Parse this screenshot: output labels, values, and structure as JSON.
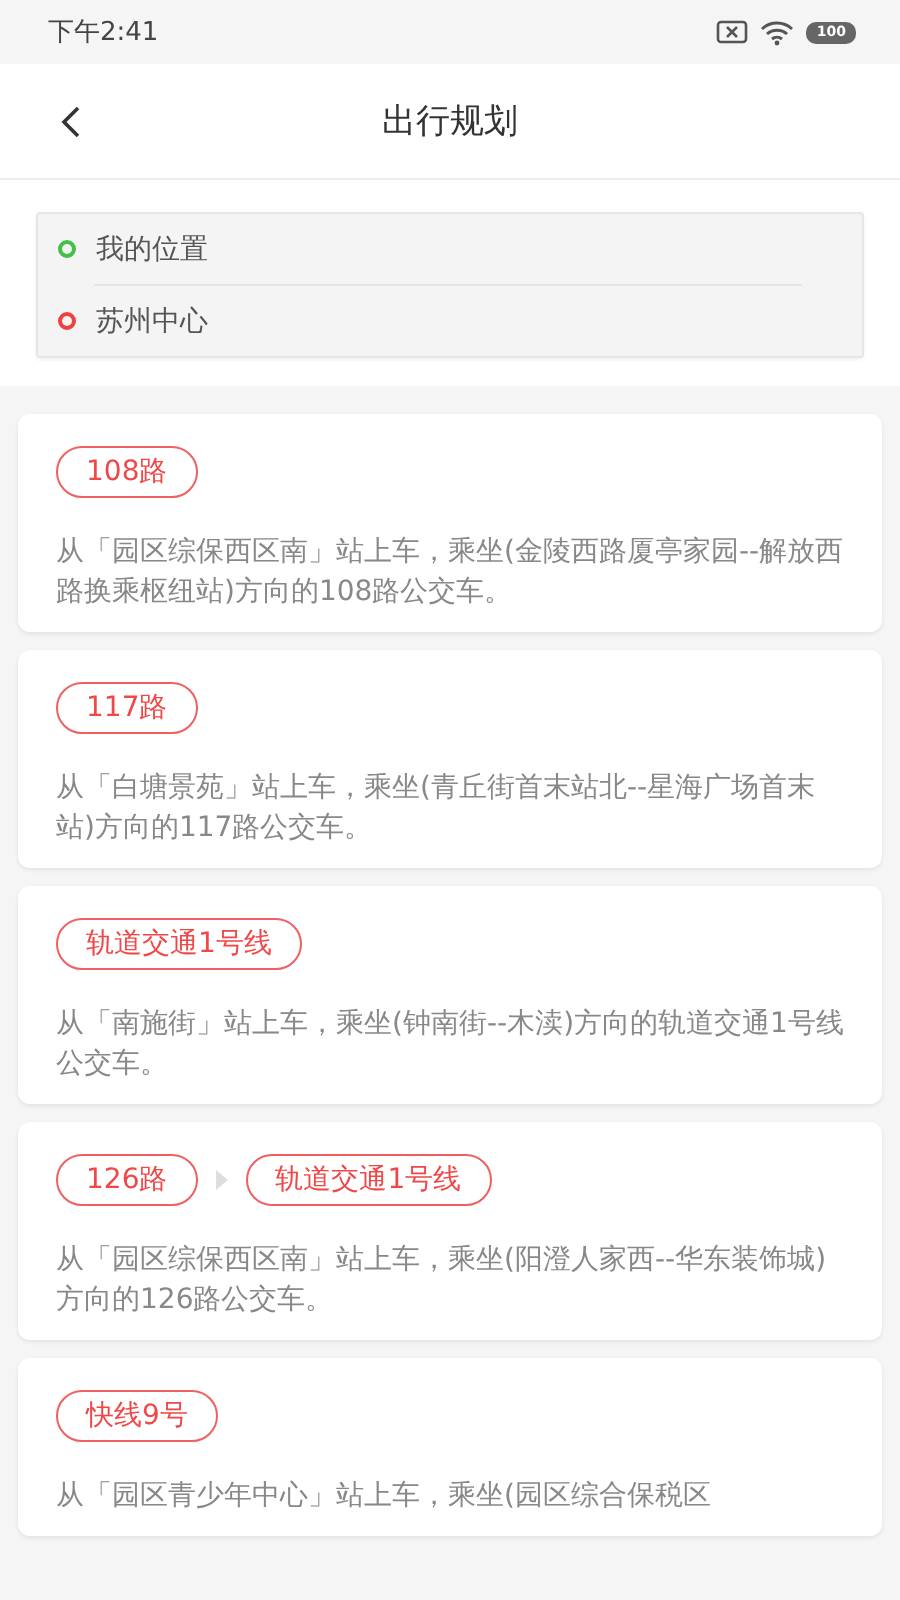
{
  "status_bar": {
    "time": "下午2:41",
    "battery": "100"
  },
  "header": {
    "title": "出行规划"
  },
  "locations": [
    {
      "label": "我的位置",
      "color": "#44c044"
    },
    {
      "label": "苏州中心",
      "color": "#f04040"
    }
  ],
  "routes": [
    {
      "lines": [
        "108路"
      ],
      "description": "从「园区综保西区南」站上车，乘坐(金陵西路厦亭家园--解放西路换乘枢纽站)方向的108路公交车。"
    },
    {
      "lines": [
        "117路"
      ],
      "description": "从「白塘景苑」站上车，乘坐(青丘街首末站北--星海广场首末站)方向的117路公交车。"
    },
    {
      "lines": [
        "轨道交通1号线"
      ],
      "description": "从「南施街」站上车，乘坐(钟南街--木渎)方向的轨道交通1号线公交车。"
    },
    {
      "lines": [
        "126路",
        "轨道交通1号线"
      ],
      "description": "从「园区综保西区南」站上车，乘坐(阳澄人家西--华东装饰城)方向的126路公交车。"
    },
    {
      "lines": [
        "快线9号"
      ],
      "description": "从「园区青少年中心」站上车，乘坐(园区综合保税区"
    }
  ]
}
